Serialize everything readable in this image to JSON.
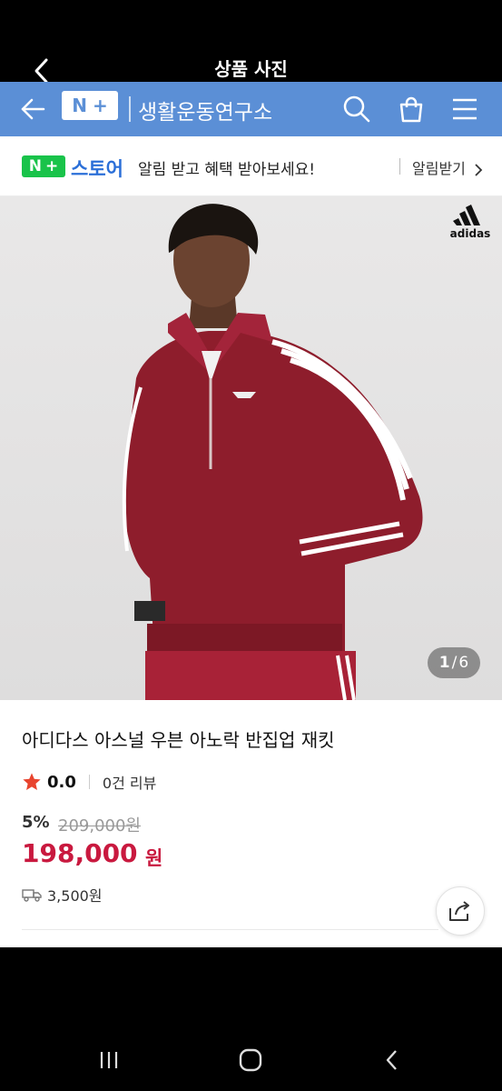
{
  "top_bar": {
    "title": "상품 사진",
    "back_icon": "chevron-left-icon"
  },
  "web_nav": {
    "logo_text": "N+",
    "logo_n": "N",
    "logo_plus": "+",
    "brand": "생활운동연구소",
    "icons": [
      "arrow-left-icon",
      "search-icon",
      "bag-icon",
      "menu-icon"
    ],
    "bg_color": "#5b8fd6"
  },
  "notice": {
    "logo_n": "N",
    "logo_plus": "+",
    "store_label": "스토어",
    "message": "알림 받고 혜택 받아보세요!",
    "alarm_link": "알림받기",
    "accent": "#19c34a"
  },
  "product_image": {
    "brand_logo": "adidas",
    "counter_current": "1",
    "counter_total": "6"
  },
  "product": {
    "name": "아디다스 아스널 우븐 아노락 반집업 재킷",
    "rating": "0.0",
    "reviews": "0건 리뷰",
    "discount": "5%",
    "original_price": "209,000원",
    "price": "198,000",
    "price_unit": "원",
    "shipping": "3,500원",
    "price_color": "#c9193f"
  },
  "system_nav": {
    "buttons": [
      "recent-apps-icon",
      "home-icon",
      "back-icon"
    ]
  }
}
